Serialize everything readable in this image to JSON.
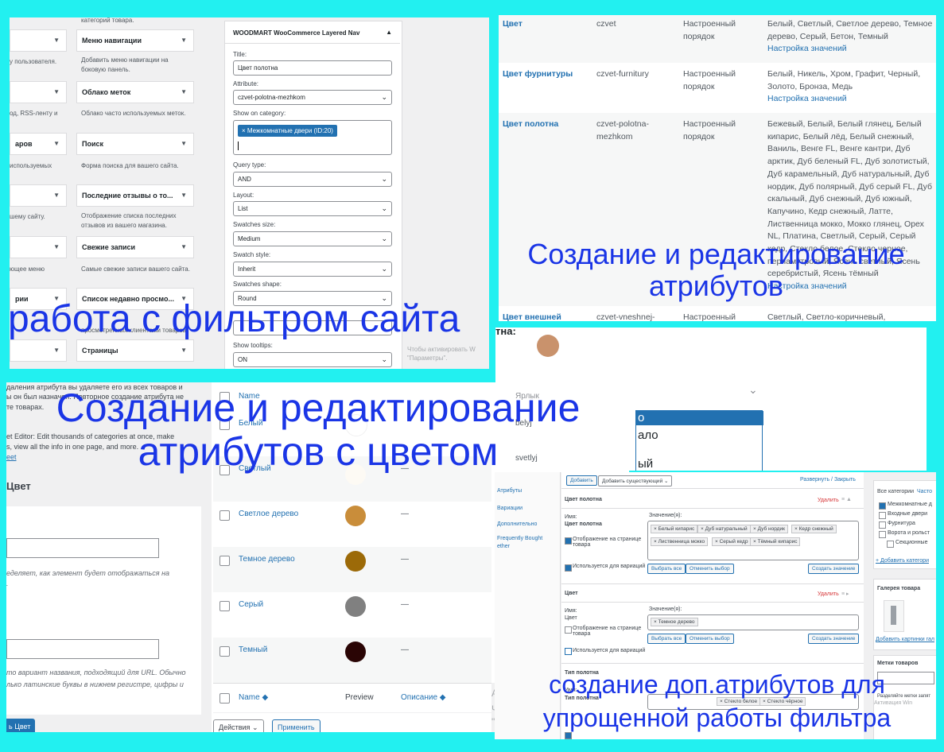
{
  "widgets": {
    "top_desc": "категорий товара.",
    "left_items": [
      {
        "label": "",
        "desc": "у пользователя."
      },
      {
        "label": "",
        "desc": "од, RSS-ленту и"
      },
      {
        "label": "аров",
        "desc": "используемых"
      },
      {
        "label": "",
        "desc": "шему сайту."
      },
      {
        "label": "",
        "desc": "ющее меню"
      },
      {
        "label": "рии",
        "desc": ""
      },
      {
        "label": "",
        "desc": ""
      }
    ],
    "right_items": [
      {
        "label": "Меню навигации",
        "desc": "Добавить меню навигации на боковую панель."
      },
      {
        "label": "Облако меток",
        "desc": "Облако часто используемых меток."
      },
      {
        "label": "Поиск",
        "desc": "Форма поиска для вашего сайта."
      },
      {
        "label": "Последние отзывы о то...",
        "desc": "Отображение списка последних отзывов из вашего магазина."
      },
      {
        "label": "Свежие записи",
        "desc": "Самые свежие записи вашего сайта."
      },
      {
        "label": "Список недавно просмо...",
        "desc": "просмотренных клиентами товаров."
      },
      {
        "label": "Страницы",
        "desc": ""
      }
    ],
    "panel_title": "WOODMART WooCommerce Layered Nav",
    "fields": {
      "title_label": "Title:",
      "title_value": "Цвет полотна",
      "attribute_label": "Attribute:",
      "attribute_value": "czvet-polotna-mezhkom",
      "category_label": "Show on category:",
      "category_tag": "× Межкомнатные двери (ID:20)",
      "query_label": "Query type:",
      "query_value": "AND",
      "layout_label": "Layout:",
      "layout_value": "List",
      "swsize_label": "Swatches size:",
      "swsize_value": "Medium",
      "swstyle_label": "Swatch style:",
      "swstyle_value": "Inherit",
      "swshape_label": "Swatches shape:",
      "swshape_value": "Round",
      "tooltips_label": "Show tooltips:",
      "tooltips_value": "ON"
    },
    "activation_text": "Чтобы активировать W \"Параметры\"."
  },
  "attributes_table": {
    "rows": [
      {
        "name": "Цвет",
        "slug": "czvet",
        "order": "Настроенный порядок",
        "values": "Белый, Светлый, Светлое дерево, Темное дерево, Серый, Бетон, Темный",
        "link": "Настройка значений"
      },
      {
        "name": "Цвет фурнитуры",
        "slug": "czvet-furnitury",
        "order": "Настроенный порядок",
        "values": "Белый, Никель, Хром, Графит, Черный, Золото, Бронза, Медь",
        "link": "Настройка значений"
      },
      {
        "name": "Цвет полотна",
        "slug": "czvet-polotna-mezhkom",
        "order": "Настроенный порядок",
        "values": "Бежевый, Белый, Белый глянец, Белый кипарис, Белый лёд, Белый снежный, Ваниль, Венге FL, Венге кантри, Дуб арктик, Дуб беленый FL, Дуб золотистый, Дуб карамельный, Дуб натуральный, Дуб нордик, Дуб полярный, Дуб серый FL, Дуб скальный, Дуб снежный, Дуб южный, Капучино, Кедр снежный, Латте, Лиственница мокко, Мокко глянец, Орех NL, Платина, Светлый, Серый, Серый кедр, Стекло белое, Стекло черное, перламутровый, Ясень светлый, Ясень серебристый, Ясень тёмный",
        "link": "Настройка значений"
      },
      {
        "name": "Цвет внешней",
        "slug": "czvet-vneshnej-",
        "order": "Настроенный",
        "values": "Светлый, Светло-коричневый,",
        "link": ""
      }
    ]
  },
  "middle_partial": {
    "label": "тна:",
    "option_selected": "о",
    "option2": "ало",
    "option3": "ый"
  },
  "terms": {
    "left_text1": "даления атрибута вы удаляете его из всех товаров и",
    "left_text2": "ы он был назначен. Повторное создание атрибута не",
    "left_text3": "те товарах.",
    "left_editor1": "et Editor: Edit thousands of categories at once, make",
    "left_editor2": "s, view all the info in one page, and more.",
    "left_editor_link": "eet",
    "section_title": "Цвет",
    "name_hint1": "еделяет, как элемент будет отображаться на",
    "name_hint2": ".",
    "slug_hint1": "то вариант названия, подходящий для URL. Обычно",
    "slug_hint2": "лько латинские буквы в нижнем регистре, цифры и",
    "add_button": "ь Цвет",
    "col_name": "Name",
    "col_preview": "Preview",
    "col_desc": "Описание",
    "col_slug": "Ярлык",
    "rows": [
      {
        "name": "Белый",
        "color": "#ffffff",
        "slug": "belyj"
      },
      {
        "name": "Светлый",
        "color": "#fdfaf4",
        "slug": "svetlyj"
      },
      {
        "name": "Светлое дерево",
        "color": "#c98d3a",
        "slug": ""
      },
      {
        "name": "Темное дерево",
        "color": "#9c6a08",
        "slug": ""
      },
      {
        "name": "Серый",
        "color": "#808080",
        "slug": ""
      },
      {
        "name": "Темный",
        "color": "#2a0505",
        "slug": ""
      }
    ],
    "dash": "—",
    "actions": "Действия",
    "apply": "Применить",
    "side_a": "A",
    "side_ch": "Ч",
    "side_q": "\""
  },
  "product": {
    "btn_add": "Добавить",
    "btn_existing": "Добавить существующий",
    "expand": "Развернуть / Закрыть",
    "side_items": [
      "Атрибуты",
      "Вариации",
      "Дополнительно",
      "Frequently Bought",
      "ether"
    ],
    "attr1": {
      "title": "Цвет полотна",
      "delete": "Удалить",
      "name_label": "Имя:",
      "name_value": "Цвет полотна",
      "values_label": "Значение(я):",
      "chips": [
        "× Белый кипарис",
        "× Дуб натуральный",
        "× Дуб нордик",
        "× Кедр снежный",
        "× Лиственница мокко",
        "× Серый кедр",
        "× Тёмный кипарис"
      ],
      "show_on_page": "Отображение на странице товара",
      "used_for_var": "Используется для вариаций",
      "select_all": "Выбрать все",
      "deselect": "Отменить выбор",
      "create_value": "Создать значение"
    },
    "attr2": {
      "title": "Цвет",
      "delete": "Удалить",
      "name_label": "Имя:",
      "name_value": "Цвет",
      "values_label": "Значение(я):",
      "chips": [
        "× Темное дерево"
      ],
      "show_on_page": "Отображение на странице товара",
      "used_for_var": "Используется для вариаций",
      "select_all": "Выбрать все",
      "deselect": "Отменить выбор",
      "create_value": "Создать значение"
    },
    "attr3": {
      "title": "Тип полотна",
      "name_label": "Имя:",
      "name_value": "Тип полотна",
      "chips": [
        "× Стекло белое",
        "× Стекло чёрное"
      ]
    },
    "right": {
      "tab_all": "Все категории",
      "tab_used": "Часто",
      "cats": [
        "Межкомнатные д",
        "Входные двери",
        "Фурнитура",
        "Ворота и рольст",
        "Секционные"
      ],
      "add_category": "+ Добавить категори",
      "gallery_title": "Галерея товара",
      "add_images": "Добавить картинки гал",
      "tags_title": "Метки товаров",
      "tags_hint": "Разделяйте метки запят",
      "activation": "Активация Win"
    }
  },
  "captions": {
    "c1": "работа с фильтром сайта",
    "c2": "Создание и редактирование атрибутов",
    "c3": "Создание и редактирование атрибутов с цветом",
    "c4": "создание доп.атрибутов для упрощенной работы фильтра"
  }
}
